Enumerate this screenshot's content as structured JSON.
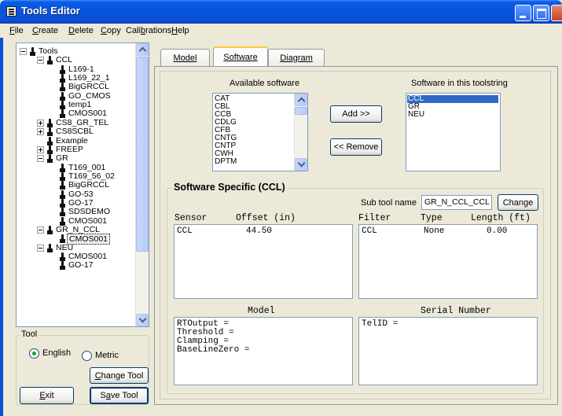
{
  "window": {
    "title": "Tools Editor"
  },
  "menu": [
    {
      "label": "File",
      "mnemonic": "F",
      "rest": "ile"
    },
    {
      "label": "Create",
      "mnemonic": "C",
      "rest": "reate"
    },
    {
      "label": "Delete",
      "mnemonic": "D",
      "rest": "elete"
    },
    {
      "label": "Copy",
      "mnemonic": "C",
      "rest": "opy"
    },
    {
      "label": "Calibrations",
      "pre": "Cali",
      "mnemonic": "b",
      "rest": "rations"
    },
    {
      "label": "Help",
      "mnemonic": "H",
      "rest": "elp"
    }
  ],
  "tree": {
    "root": "Tools",
    "nodes": [
      {
        "label": "CCL",
        "expander": "minus"
      },
      {
        "label": "L169-1"
      },
      {
        "label": "L169_22_1"
      },
      {
        "label": "BigGRCCL"
      },
      {
        "label": "GO_CMOS"
      },
      {
        "label": "temp1"
      },
      {
        "label": "CMOS001"
      },
      {
        "label": "CS8_GR_TEL",
        "expander": "plus"
      },
      {
        "label": "CS8SCBL",
        "expander": "plus"
      },
      {
        "label": "Example"
      },
      {
        "label": "FREEP",
        "expander": "plus"
      },
      {
        "label": "GR",
        "expander": "minus"
      },
      {
        "label": "T169_001"
      },
      {
        "label": "T169_56_02"
      },
      {
        "label": "BigGRCCL"
      },
      {
        "label": "GO-53"
      },
      {
        "label": "GO-17"
      },
      {
        "label": "SDSDEMO"
      },
      {
        "label": "CMOS001"
      },
      {
        "label": "GR_N_CCL",
        "expander": "minus"
      },
      {
        "label": "CMOS001",
        "selected": true
      },
      {
        "label": "NEU",
        "expander": "minus"
      },
      {
        "label": "CMOS001"
      },
      {
        "label": "GO-17"
      }
    ]
  },
  "tool_group": {
    "legend": "Tool",
    "english_label": "English",
    "metric_label": "Metric",
    "units_selected": "English",
    "change_tool_label": "Change Tool",
    "change_tool_mnemonic": "C",
    "change_tool_rest": "hange Tool"
  },
  "buttons": {
    "exit": {
      "mnemonic": "E",
      "rest": "xit"
    },
    "save_tool": {
      "pre": "S",
      "mnemonic": "a",
      "rest": "ve Tool"
    }
  },
  "tabs": [
    {
      "label": "Model",
      "active": false
    },
    {
      "label": "Software",
      "active": true
    },
    {
      "label": "Diagram",
      "active": false
    }
  ],
  "software": {
    "available_label": "Available software",
    "available_items": [
      "CAT",
      "CBL",
      "CCB",
      "CDLG",
      "CFB",
      "CNTG",
      "CNTP",
      "CWH",
      "DPTM"
    ],
    "toolstring_label": "Software in this toolstring",
    "toolstring_items": [
      "CCL",
      "GR",
      "NEU"
    ],
    "toolstring_selected": "CCL",
    "add_label": "Add >>",
    "remove_label": "<< Remove"
  },
  "specific": {
    "legend": "Software Specific (CCL)",
    "sub_tool_label": "Sub tool name",
    "sub_tool_value": "GR_N_CCL_CCL",
    "change_label": "Change",
    "sensor_headers": {
      "sensor": "Sensor",
      "offset": "Offset (in)"
    },
    "sensor_rows": [
      {
        "sensor": "CCL",
        "offset": "44.50"
      }
    ],
    "filter_headers": {
      "filter": "Filter",
      "type": "Type",
      "length": "Length (ft)"
    },
    "filter_rows": [
      {
        "filter": "CCL",
        "type": "None",
        "length": "0.00"
      }
    ],
    "model_header": "Model",
    "model_lines": [
      "RTOutput =",
      "Threshold =",
      "Clamping =",
      "BaseLineZero ="
    ],
    "serial_header": "Serial Number",
    "serial_lines": [
      "TelID ="
    ]
  }
}
